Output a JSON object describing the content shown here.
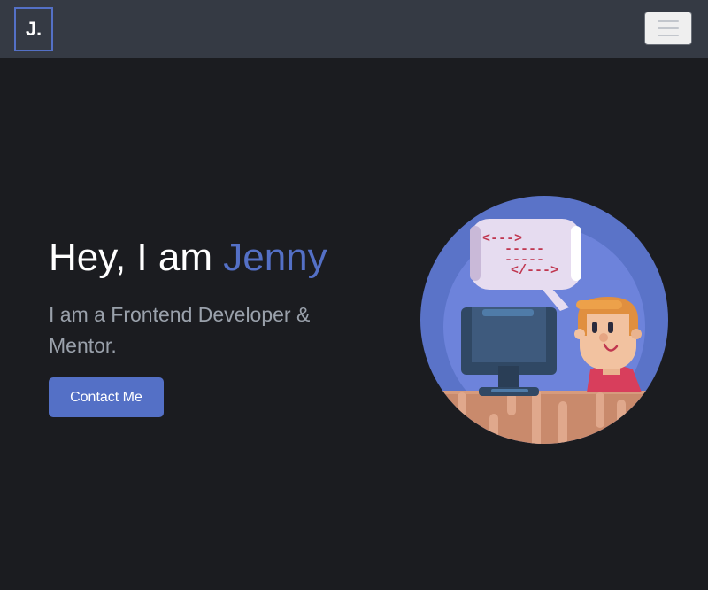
{
  "navbar": {
    "brand": "J.",
    "toggle_icon": "hamburger-menu-icon"
  },
  "hero": {
    "greeting": "Hey, I am ",
    "name": "Jenny",
    "subtitle": "I am a Frontend Developer & Mentor.",
    "cta_label": "Contact Me"
  },
  "illustration": {
    "code_lines": [
      "<--->",
      "-----",
      "-----",
      "</--->"
    ],
    "icon": "developer-at-computer-illustration"
  },
  "colors": {
    "accent": "#5470c6",
    "background": "#1b1c20",
    "navbar": "#353a44"
  }
}
